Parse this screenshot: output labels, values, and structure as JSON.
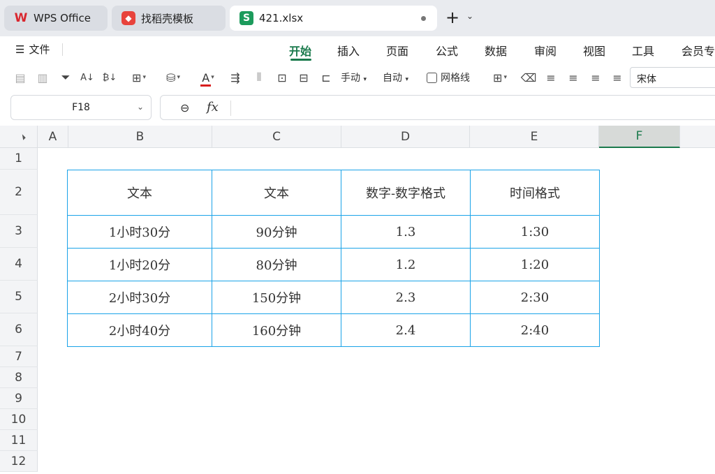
{
  "tabs": [
    {
      "label": "WPS Office",
      "icon": "wps-logo-icon"
    },
    {
      "label": "找稻壳模板",
      "icon": "docer-icon"
    },
    {
      "label": "421.xlsx",
      "icon": "spreadsheet-icon",
      "active": true
    }
  ],
  "menu": {
    "file_label": "文件",
    "items": [
      "开始",
      "插入",
      "页面",
      "公式",
      "数据",
      "审阅",
      "视图",
      "工具",
      "会员专"
    ],
    "active": "开始"
  },
  "toolbar": {
    "row_height_label": "手动",
    "col_width_label": "自动",
    "gridlines_label": "网格线",
    "font_name": "宋体",
    "font_color": "#d81e1e"
  },
  "formula_bar": {
    "cell_ref": "F18",
    "fx_label": "fx",
    "content": ""
  },
  "columns": [
    "A",
    "B",
    "C",
    "D",
    "E",
    "F"
  ],
  "selected_column": "F",
  "rows": [
    "1",
    "2",
    "3",
    "4",
    "5",
    "6",
    "7",
    "8",
    "9",
    "10",
    "11",
    "12"
  ],
  "table": {
    "headers": [
      "文本",
      "文本",
      "数字-数字格式",
      "时间格式"
    ],
    "rows": [
      [
        "1小时30分",
        "90分钟",
        "1.3",
        "1:30"
      ],
      [
        "1小时20分",
        "80分钟",
        "1.2",
        "1:20"
      ],
      [
        "2小时30分",
        "150分钟",
        "2.3",
        "2:30"
      ],
      [
        "2小时40分",
        "160分钟",
        "2.4",
        "2:40"
      ]
    ],
    "border_color": "#1aa3e8"
  },
  "theme": {
    "accent": "#1a7a4c"
  }
}
